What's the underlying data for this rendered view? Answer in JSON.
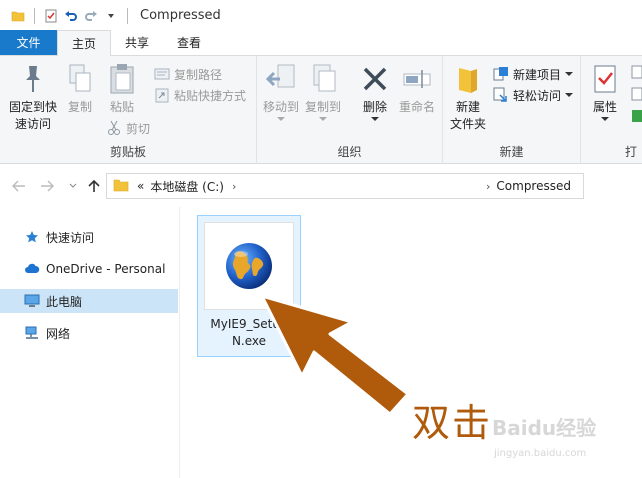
{
  "window": {
    "title": "Compressed"
  },
  "tabs": [
    {
      "label": "文件"
    },
    {
      "label": "主页"
    },
    {
      "label": "共享"
    },
    {
      "label": "查看"
    }
  ],
  "ribbon": {
    "clipboard": {
      "label": "剪贴板",
      "pin": "固定到快速访问",
      "pin_line1": "固定到快",
      "pin_line2": "速访问",
      "copy": "复制",
      "paste": "粘贴",
      "copy_path": "复制路径",
      "paste_shortcut": "粘贴快捷方式",
      "cut": "剪切"
    },
    "organize": {
      "label": "组织",
      "move_to": "移动到",
      "copy_to": "复制到",
      "delete": "删除",
      "rename": "重命名"
    },
    "new": {
      "label": "新建",
      "new_folder_line1": "新建",
      "new_folder_line2": "文件夹",
      "new_item": "新建项目",
      "easy_access": "轻松访问"
    },
    "open": {
      "label_partial": "打",
      "properties": "属性"
    }
  },
  "address": {
    "overflow": "«",
    "crumbs": [
      "本地磁盘 (C:)",
      "Compressed"
    ]
  },
  "navpane": {
    "items": [
      {
        "label": "快速访问"
      },
      {
        "label": "OneDrive - Personal"
      },
      {
        "label": "此电脑"
      },
      {
        "label": "网络"
      }
    ]
  },
  "files": [
    {
      "name_line1": "MyIE9_Setup",
      "name_line2": "N.exe"
    }
  ],
  "annotation": {
    "text": "双击"
  },
  "watermark": {
    "brand": "Baidu经验",
    "url": "jingyan.baidu.com"
  },
  "colors": {
    "file_tab": "#1979ca",
    "annotation": "#b05a0c",
    "selection": "#cce4f7",
    "folder": "#f2c33a"
  }
}
